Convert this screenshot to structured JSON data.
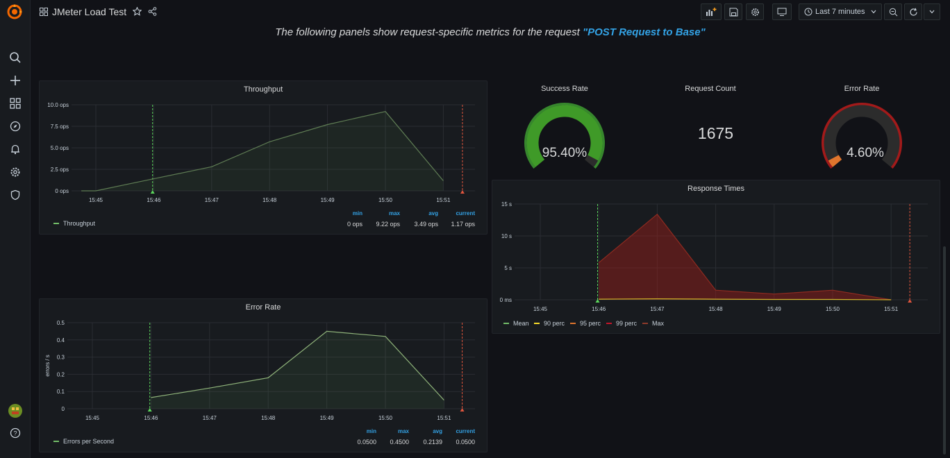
{
  "app": {
    "title": "JMeter Load Test"
  },
  "toolbar": {
    "time_range": "Last 7 minutes"
  },
  "headline": {
    "prefix": "The following panels show request-specific metrics for the request ",
    "request": "\"POST Request to Base\""
  },
  "colors": {
    "green": "#37872d",
    "gauge_green": "#3f9a28",
    "red": "#c4162a",
    "orange": "#e0752d",
    "line": "#73bf69",
    "blue": "#33a2e5",
    "yellow": "#fade2a"
  },
  "icons": [
    "grafana-logo-icon",
    "search-icon",
    "plus-icon",
    "dashboards-icon",
    "explore-icon",
    "alert-icon",
    "gear-icon",
    "shield-icon",
    "avatar",
    "help-icon"
  ],
  "throughput": {
    "title": "Throughput",
    "legend": "Throughput",
    "headers": [
      "min",
      "max",
      "avg",
      "current"
    ],
    "values": [
      "0 ops",
      "9.22 ops",
      "3.49 ops",
      "1.17 ops"
    ]
  },
  "error_rate_panel": {
    "title": "Error Rate",
    "legend": "Errors per Second",
    "headers": [
      "min",
      "max",
      "avg",
      "current"
    ],
    "values": [
      "0.0500",
      "0.4500",
      "0.2139",
      "0.0500"
    ]
  },
  "success_rate": {
    "title": "Success Rate",
    "value": "95.40%",
    "fraction": 0.954
  },
  "request_count": {
    "title": "Request Count",
    "value": "1675"
  },
  "error_rate_stat": {
    "title": "Error Rate",
    "value": "4.60%",
    "fraction": 0.046
  },
  "response_times": {
    "title": "Response Times",
    "legend": [
      "Mean",
      "90 perc",
      "95 perc",
      "99 perc",
      "Max"
    ]
  },
  "chart_data": [
    {
      "type": "area",
      "title": "Throughput",
      "x": [
        "15:45",
        "15:46",
        "15:47",
        "15:48",
        "15:49",
        "15:50",
        "15:51"
      ],
      "yticks": [
        "0 ops",
        "2.5 ops",
        "5.0 ops",
        "7.5 ops",
        "10.0 ops"
      ],
      "ylim": [
        0,
        10
      ],
      "series": [
        {
          "name": "Throughput",
          "points": [
            [
              -0.25,
              0
            ],
            [
              0,
              0
            ],
            [
              1,
              1.4
            ],
            [
              2,
              2.8
            ],
            [
              3,
              5.7
            ],
            [
              4,
              7.7
            ],
            [
              5,
              9.22
            ],
            [
              6,
              1.17
            ]
          ]
        }
      ]
    },
    {
      "type": "area",
      "title": "Error Rate",
      "ylabel": "errors / s",
      "x": [
        "15:45",
        "15:46",
        "15:47",
        "15:48",
        "15:49",
        "15:50",
        "15:51"
      ],
      "yticks": [
        "0",
        "0.1",
        "0.2",
        "0.3",
        "0.4",
        "0.5"
      ],
      "ylim": [
        0,
        0.5
      ],
      "series": [
        {
          "name": "Errors per Second",
          "points": [
            [
              1,
              0.065
            ],
            [
              2,
              0.12
            ],
            [
              3,
              0.18
            ],
            [
              4,
              0.45
            ],
            [
              5,
              0.42
            ],
            [
              6,
              0.05
            ]
          ]
        }
      ]
    },
    {
      "type": "area",
      "title": "Response Times",
      "x": [
        "15:45",
        "15:46",
        "15:47",
        "15:48",
        "15:49",
        "15:50",
        "15:51"
      ],
      "yticks": [
        "0 ms",
        "5 s",
        "10 s",
        "15 s"
      ],
      "ylim": [
        0,
        15
      ],
      "series": [
        {
          "name": "Max",
          "points": [
            [
              1,
              5.8
            ],
            [
              2,
              13.4
            ],
            [
              3,
              1.5
            ],
            [
              4,
              0.9
            ],
            [
              5,
              1.5
            ],
            [
              6,
              0
            ]
          ]
        },
        {
          "name": "Mean",
          "points": [
            [
              1,
              0.1
            ],
            [
              2,
              0.15
            ],
            [
              3,
              0.1
            ],
            [
              4,
              0.05
            ],
            [
              5,
              0.05
            ],
            [
              6,
              0
            ]
          ]
        }
      ]
    }
  ]
}
